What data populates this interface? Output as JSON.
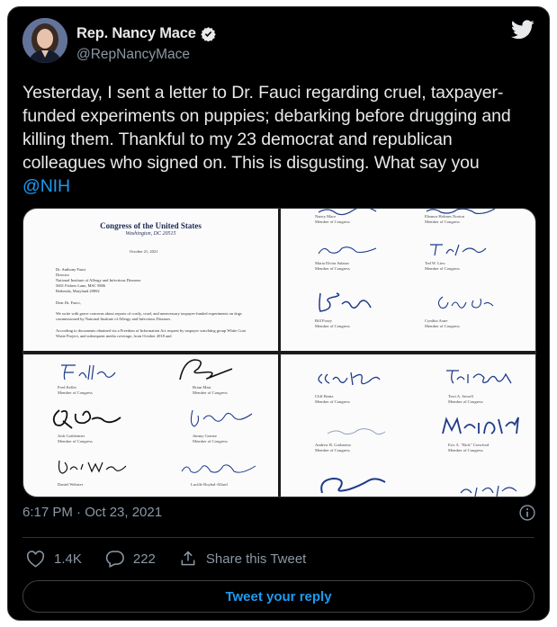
{
  "author": {
    "name": "Rep. Nancy Mace",
    "handle": "@RepNancyMace",
    "verified": true,
    "avatar": "avatar-photo"
  },
  "brand_icon": "twitter-bird-icon",
  "tweet": {
    "text": "Yesterday, I sent a letter to Dr. Fauci regarding cruel, taxpayer-funded experiments on puppies; debarking before drugging and killing them. Thankful to my 23 democrat and republican colleagues who signed on. This is disgusting. What say you ",
    "mention": "@NIH"
  },
  "media": {
    "letter": {
      "heading": "Congress of the United States",
      "location": "Washington, DC 20515",
      "date": "October 21, 2021",
      "address": [
        "Dr. Anthony Fauci",
        "Director",
        "National Institute of Allergy and Infectious Diseases",
        "5601 Fishers Lane, MSC 9806",
        "Bethesda, Maryland 20892"
      ],
      "salutation": "Dear Dr. Fauci,",
      "para1": "We write with grave concerns about reports of costly, cruel, and unnecessary taxpayer-funded experiments on dogs commissioned by National Institute of Allergy and Infectious Diseases.",
      "para2": "According to documents obtained via a Freedom of Information Act request by taxpayer watchdog group White Coat Waste Project, and subsequent media coverage, from October 2018 and"
    },
    "sigs_page2": [
      {
        "name": "Nancy Mace",
        "role": "Member of Congress"
      },
      {
        "name": "Eleanor Holmes Norton",
        "role": "Member of Congress"
      },
      {
        "name": "Maria Elvira Salazar",
        "role": "Member of Congress"
      },
      {
        "name": "Ted W. Lieu",
        "role": "Member of Congress"
      },
      {
        "name": "Bill Posey",
        "role": "Member of Congress"
      },
      {
        "name": "Cynthia Axne",
        "role": "Member of Congress"
      }
    ],
    "sigs_page3": [
      {
        "name": "Fred Keller",
        "role": "Member of Congress"
      },
      {
        "name": "Brian Mast",
        "role": "Member of Congress"
      },
      {
        "name": "Josh Gottheimer",
        "role": "Member of Congress"
      },
      {
        "name": "Jimmy Gomez",
        "role": "Member of Congress"
      },
      {
        "name": "Daniel Webster",
        "role": ""
      },
      {
        "name": "Lucille Roybal-Allard",
        "role": ""
      }
    ],
    "sigs_page4": [
      {
        "name": "Cliff Bentz",
        "role": "Member of Congress"
      },
      {
        "name": "Terri A. Sewell",
        "role": "Member of Congress"
      },
      {
        "name": "Andrew R. Garbarino",
        "role": "Member of Congress"
      },
      {
        "name": "Eric A. \"Rick\" Crawford",
        "role": "Member of Congress"
      }
    ]
  },
  "timestamp": "6:17 PM · Oct 23, 2021",
  "actions": {
    "likes": "1.4K",
    "replies": "222",
    "share_label": "Share this Tweet"
  },
  "reply_button": "Tweet your reply",
  "colors": {
    "background": "#000000",
    "text": "#e7e9ea",
    "muted": "#8b98a5",
    "accent": "#1d9bf0"
  }
}
